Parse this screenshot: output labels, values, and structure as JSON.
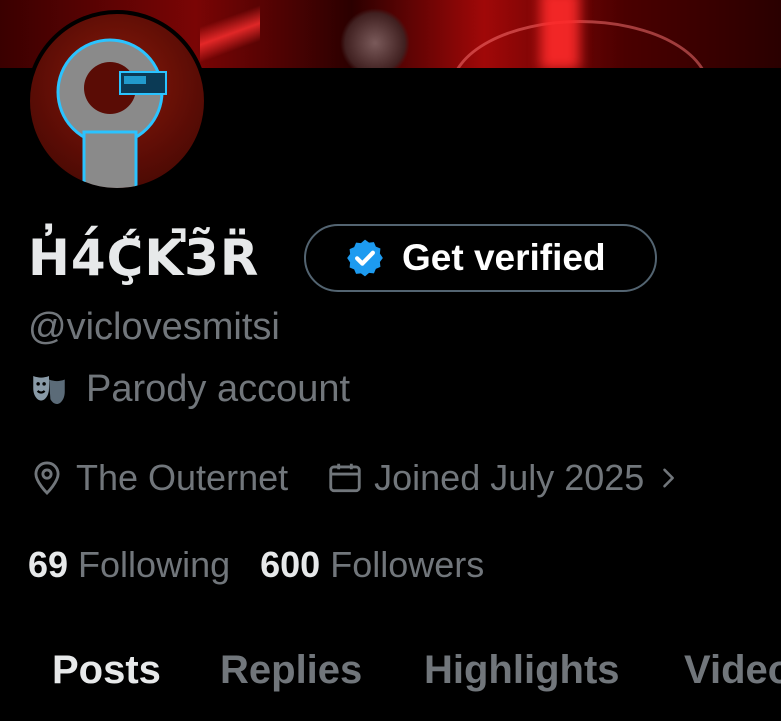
{
  "profile": {
    "display_name": "H̓4́Ḉ̆K̚3̃R̈",
    "verify_button_label": "Get verified",
    "handle": "@viclovesmitsi",
    "parody_label": "Parody account",
    "location": "The Outernet",
    "joined": "Joined July 2025",
    "following_count": "69",
    "following_label": "Following",
    "followers_count": "600",
    "followers_label": "Followers"
  },
  "tabs": [
    {
      "label": "Posts"
    },
    {
      "label": "Replies"
    },
    {
      "label": "Highlights"
    },
    {
      "label": "Videos"
    }
  ],
  "icons": {
    "verify": "verified-badge-icon",
    "parody": "theater-mask-icon",
    "location": "location-pin-icon",
    "joined": "calendar-icon",
    "chevron": "chevron-right-icon"
  },
  "colors": {
    "background": "#000000",
    "text_primary": "#e7e9ea",
    "text_secondary": "#71767b",
    "verified_blue": "#1d9bf0",
    "button_border": "#536471",
    "banner_red": "#a00808"
  }
}
